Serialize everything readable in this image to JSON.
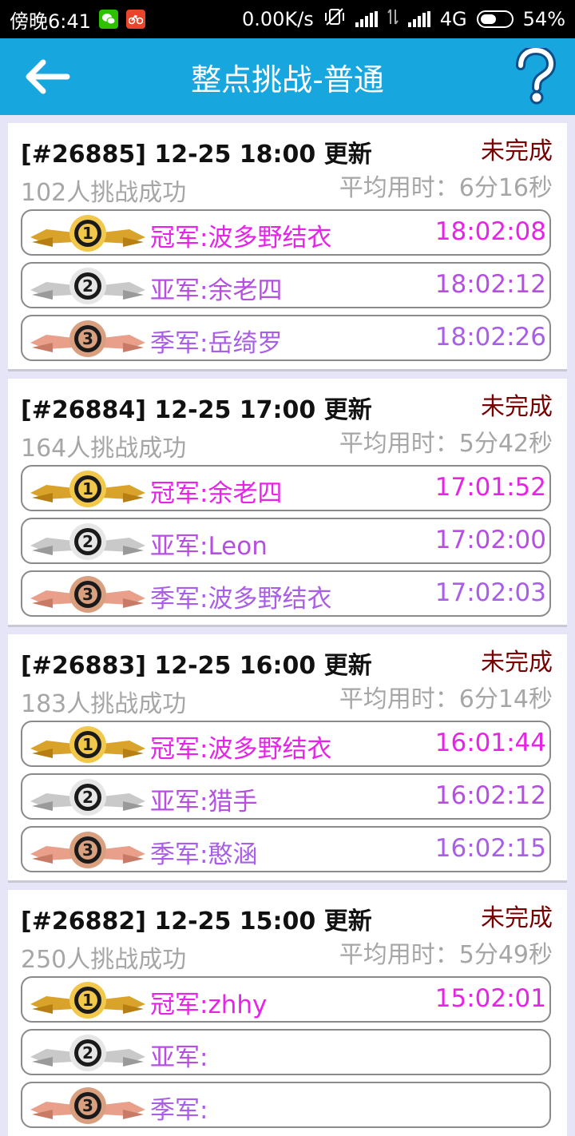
{
  "status_bar": {
    "time": "傍晚6:41",
    "net_speed": "0.00K/s",
    "network": "4G",
    "battery": "54%",
    "battery_level": 0.54,
    "icons": [
      "wechat-icon",
      "app-notification-icon",
      "mute-vibrate-icon",
      "signal-icon",
      "data-arrows-icon",
      "signal-icon",
      "battery-icon"
    ]
  },
  "header": {
    "title": "整点挑战-普通",
    "back_icon": "arrow-left-icon",
    "help_icon": "question-mark-icon",
    "color": "#17a6dd"
  },
  "colors": {
    "gold_text": "#e623e6",
    "silver_text": "#b54fe0",
    "bronze_text": "#a85ee6",
    "status_text": "#7a0000"
  },
  "challenges": [
    {
      "heading": "[#26885] 12-25 18:00 更新",
      "status": "未完成",
      "count": "102人挑战成功",
      "avg": "平均用时：6分16秒",
      "ranks": [
        {
          "label": "冠军:波多野结衣",
          "time": "18:02:08"
        },
        {
          "label": "亚军:余老四",
          "time": "18:02:12"
        },
        {
          "label": "季军:岳绮罗",
          "time": "18:02:26"
        }
      ]
    },
    {
      "heading": "[#26884] 12-25 17:00 更新",
      "status": "未完成",
      "count": "164人挑战成功",
      "avg": "平均用时：5分42秒",
      "ranks": [
        {
          "label": "冠军:余老四",
          "time": "17:01:52"
        },
        {
          "label": "亚军:Leon",
          "time": "17:02:00"
        },
        {
          "label": "季军:波多野结衣",
          "time": "17:02:03"
        }
      ]
    },
    {
      "heading": "[#26883] 12-25 16:00 更新",
      "status": "未完成",
      "count": "183人挑战成功",
      "avg": "平均用时：6分14秒",
      "ranks": [
        {
          "label": "冠军:波多野结衣",
          "time": "16:01:44"
        },
        {
          "label": "亚军:猎手",
          "time": "16:02:12"
        },
        {
          "label": "季军:憨涵",
          "time": "16:02:15"
        }
      ]
    },
    {
      "heading": "[#26882] 12-25 15:00 更新",
      "status": "未完成",
      "count": "250人挑战成功",
      "avg": "平均用时：5分49秒",
      "ranks": [
        {
          "label": "冠军:zhhy",
          "time": "15:02:01"
        },
        {
          "label": "亚军:",
          "time": ""
        },
        {
          "label": "季军:",
          "time": ""
        }
      ]
    }
  ]
}
